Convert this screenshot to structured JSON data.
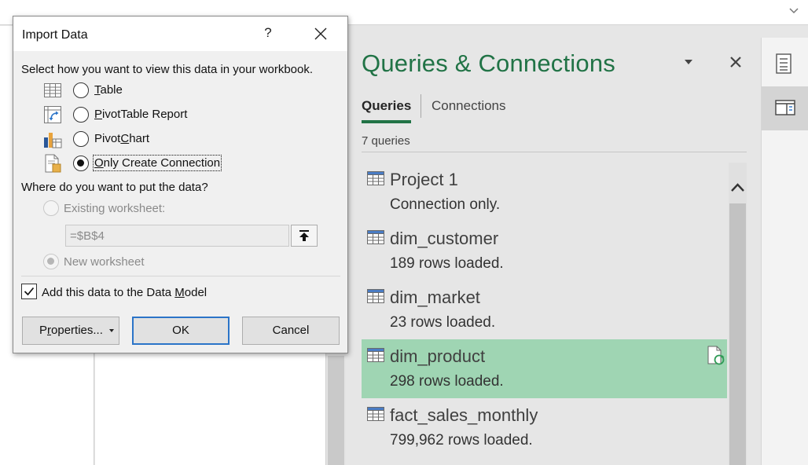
{
  "pane": {
    "title": "Queries & Connections",
    "tabs": [
      {
        "label": "Queries",
        "active": true
      },
      {
        "label": "Connections",
        "active": false
      }
    ],
    "count": "7 queries",
    "queries": [
      {
        "name": "Project 1",
        "status": "Connection only.",
        "selected": false
      },
      {
        "name": "dim_customer",
        "status": "189 rows loaded.",
        "selected": false
      },
      {
        "name": "dim_market",
        "status": "23 rows loaded.",
        "selected": false
      },
      {
        "name": "dim_product",
        "status": "298 rows loaded.",
        "selected": true
      },
      {
        "name": "fact_sales_monthly",
        "status": "799,962 rows loaded.",
        "selected": false
      }
    ],
    "icons": {
      "menu": "chevron-down-icon",
      "close": "close-icon",
      "table": "table-icon",
      "refresh": "refresh-document-icon"
    }
  },
  "dialog": {
    "title": "Import Data",
    "help": "?",
    "prompt": "Select how you want to view this data in your workbook.",
    "view_options": [
      {
        "pre": "",
        "key": "T",
        "post": "able",
        "checked": false,
        "icon": "table-icon"
      },
      {
        "pre": "",
        "key": "P",
        "post": "ivotTable Report",
        "checked": false,
        "icon": "pivottable-icon"
      },
      {
        "pre": "Pivot",
        "key": "C",
        "post": "hart",
        "checked": false,
        "icon": "pivotchart-icon"
      },
      {
        "pre": "",
        "key": "O",
        "post": "nly Create Connection",
        "checked": true,
        "icon": "connection-icon"
      }
    ],
    "where_prompt": "Where do you want to put the data?",
    "existing_label": "Existing worksheet:",
    "existing_value": "=$B$4",
    "new_label": "New worksheet",
    "data_model": {
      "pre": "Add this data to the Data ",
      "key": "M",
      "post": "odel",
      "checked": true
    },
    "buttons": {
      "properties": {
        "pre": "P",
        "key": "r",
        "post": "operties..."
      },
      "ok": "OK",
      "cancel": "Cancel"
    }
  },
  "colors": {
    "accent_green": "#217346",
    "selected_row": "#9fd5b3",
    "ok_border": "#2b74c8"
  }
}
